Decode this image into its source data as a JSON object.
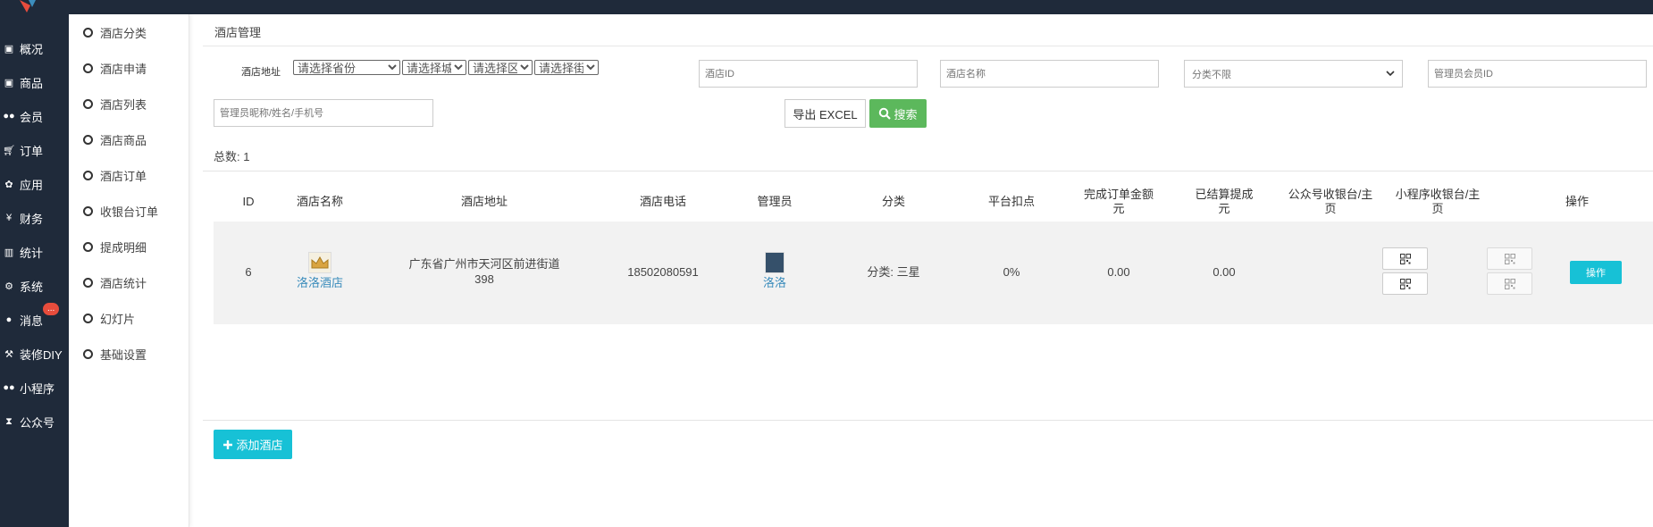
{
  "sidebar": {
    "items": [
      {
        "label": "概况",
        "icon": "dashboard-icon"
      },
      {
        "label": "商品",
        "icon": "product-icon"
      },
      {
        "label": "会员",
        "icon": "users-icon"
      },
      {
        "label": "订单",
        "icon": "cart-icon"
      },
      {
        "label": "应用",
        "icon": "apps-icon"
      },
      {
        "label": "财务",
        "icon": "yen-icon"
      },
      {
        "label": "统计",
        "icon": "bar-chart-icon"
      },
      {
        "label": "系统",
        "icon": "gears-icon"
      },
      {
        "label": "消息",
        "icon": "comment-icon",
        "badge": "..."
      },
      {
        "label": "装修DIY",
        "icon": "gavel-icon"
      },
      {
        "label": "小程序",
        "icon": "wechat-icon"
      },
      {
        "label": "公众号",
        "icon": "hourglass-icon"
      }
    ]
  },
  "subnav": {
    "items": [
      "酒店分类",
      "酒店申请",
      "酒店列表",
      "酒店商品",
      "酒店订单",
      "收银台订单",
      "提成明细",
      "酒店统计",
      "幻灯片",
      "基础设置"
    ]
  },
  "breadcrumb": "酒店管理",
  "filters": {
    "address_label": "酒店地址",
    "province": "请选择省份",
    "city": "请选择城市",
    "district": "请选择区域",
    "street": "请选择街道",
    "hotel_id_placeholder": "酒店ID",
    "hotel_name_placeholder": "酒店名称",
    "category": "分类不限",
    "admin_member_id_placeholder": "管理员会员ID",
    "admin_search_placeholder": "管理员昵称/姓名/手机号",
    "export_label": "导出 EXCEL",
    "search_label": "搜索"
  },
  "total": {
    "label": "总数:",
    "value": "1"
  },
  "table": {
    "headers": [
      "ID",
      "酒店名称",
      "酒店地址",
      "酒店电话",
      "管理员",
      "分类",
      "平台扣点",
      "完成订单金额\n元",
      "已结算提成\n元",
      "公众号收银台/主\n页",
      "小程序收银台/主\n页",
      "操作"
    ],
    "rows": [
      {
        "id": "6",
        "name": "洛洛酒店",
        "address": "广东省广州市天河区前进街道\n398",
        "phone": "18502080591",
        "admin": "洛洛",
        "category": "分类: 三星",
        "commission": "0%",
        "completed_amount": "0.00",
        "settled": "0.00",
        "action": "操作"
      }
    ]
  },
  "add_button": "添加酒店",
  "colors": {
    "sidebar": "#1f2a3a",
    "search": "#5cb85c",
    "accent": "#17c1d6",
    "link": "#3c8dbc",
    "badge": "#e74c3c"
  }
}
